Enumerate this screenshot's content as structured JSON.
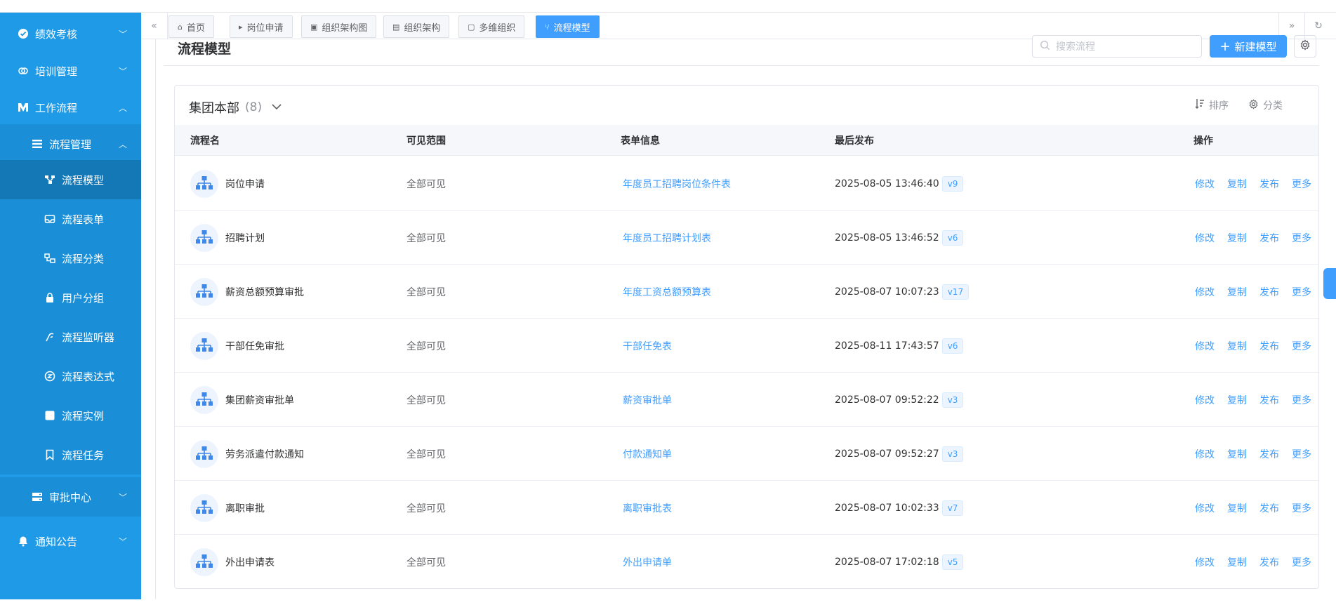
{
  "sidebar": {
    "items": [
      {
        "label": "绩效考核",
        "icon": "check-circle-icon",
        "chevron": "﹀"
      },
      {
        "label": "培训管理",
        "icon": "link-icon",
        "chevron": "﹀"
      },
      {
        "label": "工作流程",
        "icon": "workflow-icon",
        "chevron": "︿"
      },
      {
        "label": "流程管理",
        "icon": "list-icon",
        "chevron": "︿"
      },
      {
        "label": "流程模型",
        "icon": "share-nodes-icon"
      },
      {
        "label": "流程表单",
        "icon": "inbox-icon"
      },
      {
        "label": "流程分类",
        "icon": "category-icon"
      },
      {
        "label": "用户分组",
        "icon": "lock-user-icon"
      },
      {
        "label": "流程监听器",
        "icon": "listener-icon"
      },
      {
        "label": "流程表达式",
        "icon": "expression-icon"
      },
      {
        "label": "流程实例",
        "icon": "instance-icon"
      },
      {
        "label": "流程任务",
        "icon": "bookmark-icon"
      },
      {
        "label": "审批中心",
        "icon": "server-icon",
        "chevron": "﹀"
      },
      {
        "label": "通知公告",
        "icon": "bell-icon",
        "chevron": "﹀"
      }
    ]
  },
  "tabs": [
    {
      "label": "首页",
      "icon": "home-icon",
      "glyph": "⌂"
    },
    {
      "label": "岗位申请",
      "icon": "caret-right-icon",
      "glyph": "▸"
    },
    {
      "label": "组织架构图",
      "icon": "org-chart-icon",
      "glyph": "▣"
    },
    {
      "label": "组织架构",
      "icon": "id-card-icon",
      "glyph": "▤"
    },
    {
      "label": "多维组织",
      "icon": "briefcase-icon",
      "glyph": "▢"
    },
    {
      "label": "流程模型",
      "icon": "share-nodes-icon",
      "glyph": "⑂",
      "active": true
    }
  ],
  "page": {
    "title": "流程模型",
    "search_placeholder": "搜索流程",
    "new_button": "新建模型"
  },
  "group": {
    "name": "集团本部",
    "count": "(8)",
    "sort_label": "排序",
    "category_label": "分类"
  },
  "table": {
    "columns": [
      "流程名",
      "可见范围",
      "表单信息",
      "最后发布",
      "操作"
    ],
    "rows": [
      {
        "name": "岗位申请",
        "scope": "全部可见",
        "form": "年度员工招聘岗位条件表",
        "published": "2025-08-05 13:46:40",
        "version": "v9"
      },
      {
        "name": "招聘计划",
        "scope": "全部可见",
        "form": "年度员工招聘计划表",
        "published": "2025-08-05 13:46:52",
        "version": "v6"
      },
      {
        "name": "薪资总额预算审批",
        "scope": "全部可见",
        "form": "年度工资总额预算表",
        "published": "2025-08-07 10:07:23",
        "version": "v17"
      },
      {
        "name": "干部任免审批",
        "scope": "全部可见",
        "form": "干部任免表",
        "published": "2025-08-11 17:43:57",
        "version": "v6"
      },
      {
        "name": "集团薪资审批单",
        "scope": "全部可见",
        "form": "薪资审批单",
        "published": "2025-08-07 09:52:22",
        "version": "v3"
      },
      {
        "name": "劳务派遣付款通知",
        "scope": "全部可见",
        "form": "付款通知单",
        "published": "2025-08-07 09:52:27",
        "version": "v3"
      },
      {
        "name": "离职审批",
        "scope": "全部可见",
        "form": "离职审批表",
        "published": "2025-08-07 10:02:33",
        "version": "v7"
      },
      {
        "name": "外出申请表",
        "scope": "全部可见",
        "form": "外出申请单",
        "published": "2025-08-07 17:02:18",
        "version": "v5"
      }
    ],
    "actions": [
      "修改",
      "复制",
      "发布",
      "更多"
    ]
  },
  "colors": {
    "sidebar": "#1f9ae6",
    "sidebar_active": "#1578b6",
    "primary": "#409eff"
  }
}
